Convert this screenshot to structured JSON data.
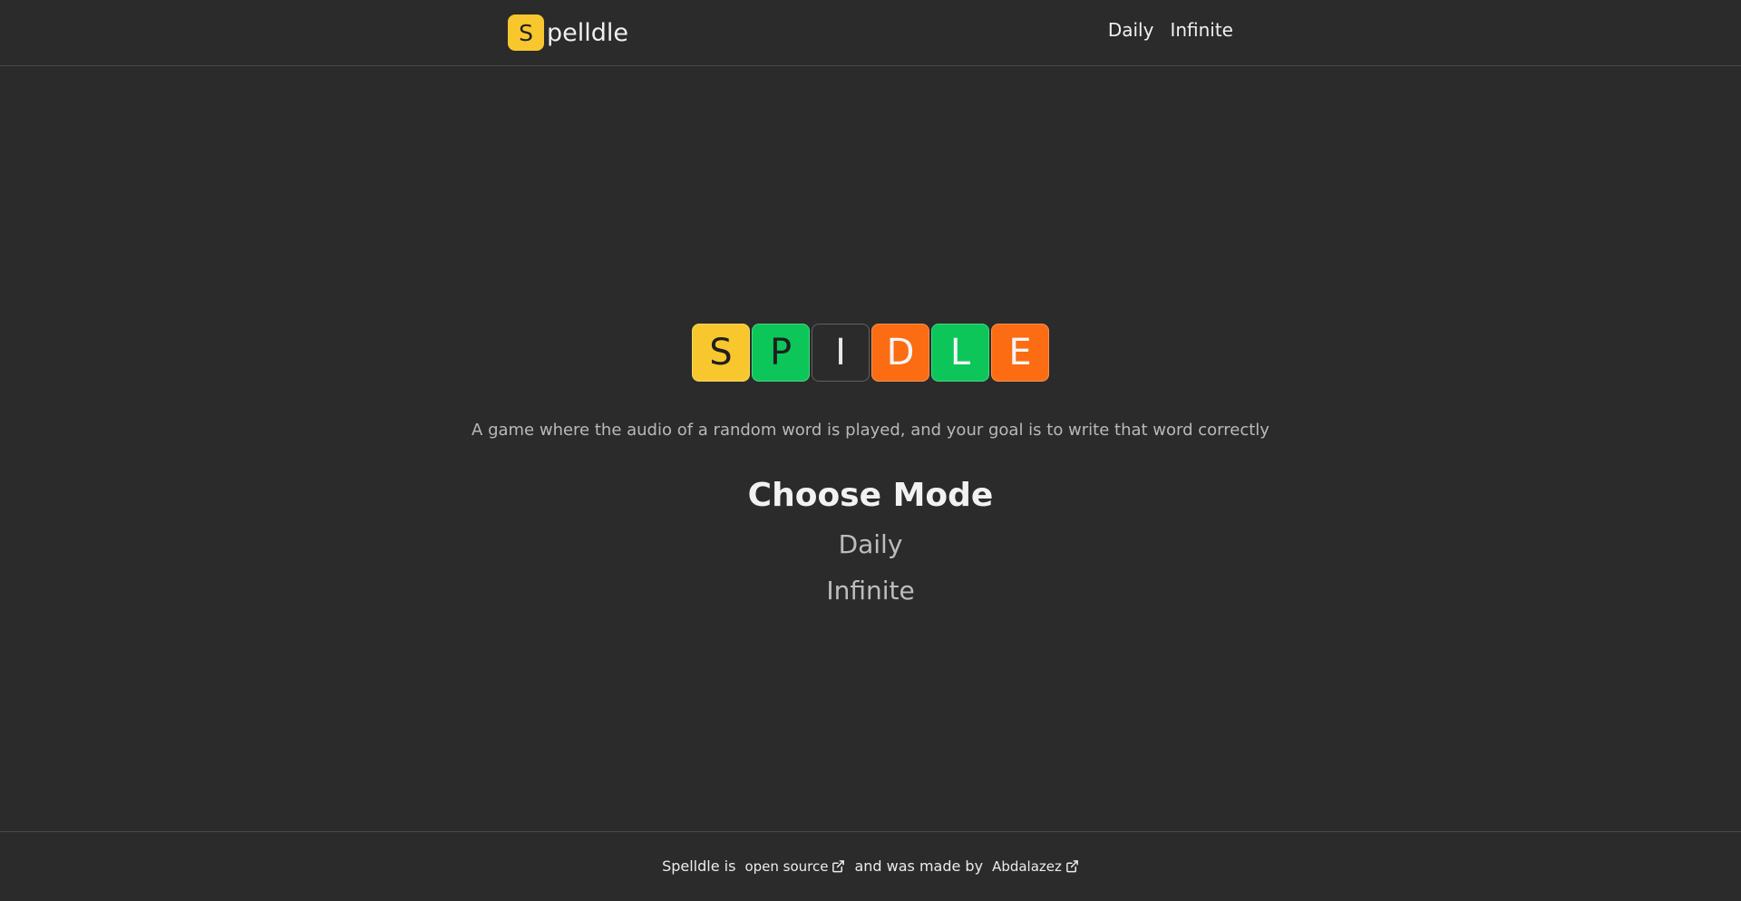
{
  "header": {
    "brand_initial": "S",
    "brand_rest": "pelldle",
    "nav": [
      {
        "label": "Daily"
      },
      {
        "label": "Infinite"
      }
    ]
  },
  "logo": {
    "tiles": [
      {
        "letter": "S",
        "color": "#f7c72d",
        "text_color": "#1f1f1f"
      },
      {
        "letter": "P",
        "color": "#0cc659",
        "text_color": "#1f1f1f"
      },
      {
        "letter": "I",
        "color": "#2b2b2b",
        "text_color": "#e8e8e8"
      },
      {
        "letter": "D",
        "color": "#fb6c13",
        "text_color": "#f4f4f4"
      },
      {
        "letter": "L",
        "color": "#0cc659",
        "text_color": "#f4f4f4"
      },
      {
        "letter": "E",
        "color": "#fb6c13",
        "text_color": "#f4f4f4"
      }
    ]
  },
  "main": {
    "tagline": "A game where the audio of a random word is played, and your goal is to write that word correctly",
    "mode_title": "Choose Mode",
    "modes": [
      {
        "label": "Daily"
      },
      {
        "label": "Infinite"
      }
    ]
  },
  "footer": {
    "prefix": "Spelldle is",
    "source_link": "open source",
    "middle": "and was made by",
    "author_link": "Abdalazez",
    "link_icon": "external-link-icon"
  },
  "colors": {
    "background": "#2b2b2b",
    "yellow": "#f7c72d",
    "green": "#0cc659",
    "orange": "#fb6c13"
  }
}
